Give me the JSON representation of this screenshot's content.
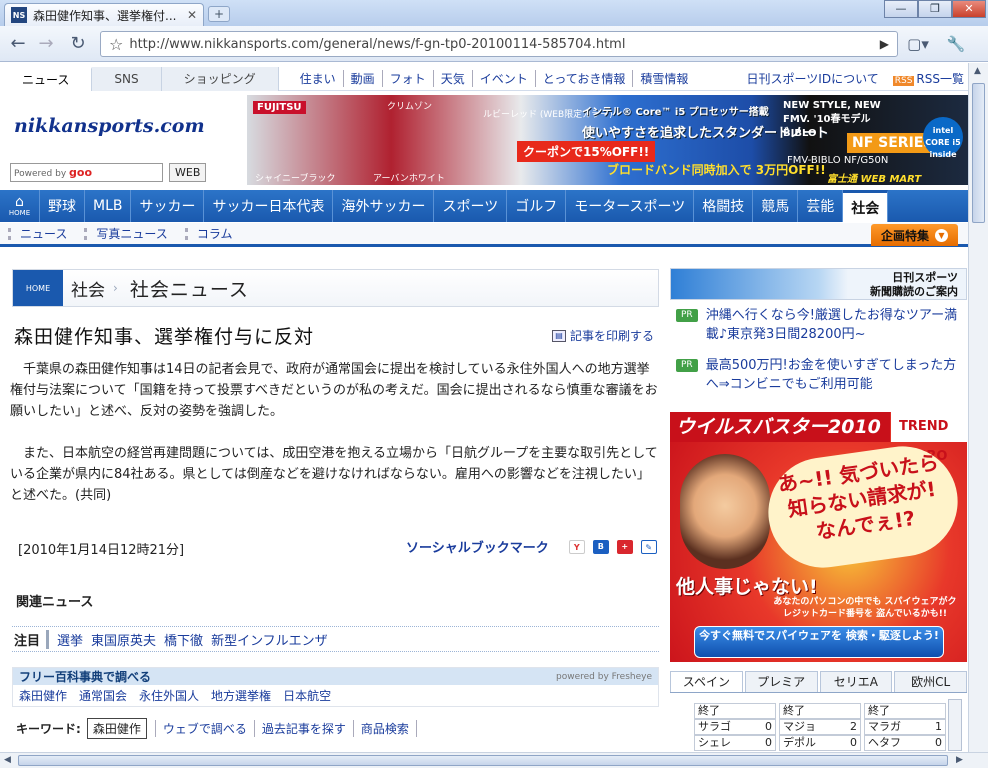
{
  "browser": {
    "tab_title": "森田健作知事、選挙権付...",
    "tab_favicon": "nikkansports-favicon",
    "url": "http://www.nikkansports.com/general/news/f-gn-tp0-20100114-585704.html"
  },
  "site": {
    "topnav_tabs": [
      "ニュース",
      "SNS",
      "ショッピング"
    ],
    "topnav_links": [
      "住まい",
      "動画",
      "フォト",
      "天気",
      "イベント",
      "とっておき情報",
      "積雪情報"
    ],
    "topnav_right": [
      "日刊スポーツIDについて",
      "RSS一覧"
    ],
    "logo": "nikkansports.com",
    "search_placeholder": "Powered by goo",
    "search_brand": "goo",
    "search_button": "WEB",
    "main_nav": [
      "野球",
      "MLB",
      "サッカー",
      "サッカー日本代表",
      "海外サッカー",
      "スポーツ",
      "ゴルフ",
      "モータースポーツ",
      "格闘技",
      "競馬",
      "芸能",
      "社会"
    ],
    "main_nav_home": "HOME",
    "sub_nav": [
      "ニュース",
      "写真ニュース",
      "コラム"
    ],
    "special_feature": "企画特集"
  },
  "banner": {
    "brand": "FUJITSU",
    "headline_small": "インテル® Core™ i5 プロセッサー搭載",
    "headline": "使いやすさを追求したスタンダードノート",
    "coupon": "クーポンで15%OFF!!",
    "price": "ブロードバンド同時加入で 3万円OFF!!",
    "biblo": "NEW STYLE, NEW FMV. '10春モデル BIBLO",
    "series": "NF SERIES",
    "model": "FMV-BIBLO NF/G50N",
    "webmart": "富士通 WEB MART",
    "colors": [
      "クリムゾン",
      "ルビーレッド (WEB限定カラー)",
      "シャイニーブラック",
      "アーバンホワイト"
    ],
    "intel_badge": "intel CORE i5 inside"
  },
  "article": {
    "breadcrumb_home": "HOME",
    "breadcrumb": [
      "社会",
      "社会ニュース"
    ],
    "title": "森田健作知事、選挙権付与に反対",
    "print_link": "記事を印刷する",
    "paragraphs": [
      "千葉県の森田健作知事は14日の記者会見で、政府が通常国会に提出を検討している永住外国人への地方選挙権付与法案について「国籍を持って投票すべきだというのが私の考えだ。国会に提出されるなら慎重な審議をお願いしたい」と述べ、反対の姿勢を強調した。",
      "また、日本航空の経営再建問題については、成田空港を抱える立場から「日航グループを主要な取引先としている企業が県内に84社ある。県としては倒産などを避けなければならない。雇用への影響などを注視したい」と述べた。(共同)"
    ],
    "dateline": "[2010年1月14日12時21分]",
    "social_bookmark": "ソーシャルブックマーク",
    "bookmark_icons": [
      "yahoo-bookmark-icon",
      "hatena-bookmark-icon",
      "livedoor-clip-icon",
      "edit-bookmark-icon"
    ],
    "related_label": "関連ニュース",
    "attention_label": "注目",
    "attention_links": [
      "選挙",
      "東国原英夫",
      "橋下徹",
      "新型インフルエンザ"
    ],
    "wiki_label": "フリー百科事典で調べる",
    "wiki_powered": "powered by Fresheye",
    "wiki_links": [
      "森田健作",
      "通常国会",
      "永住外国人",
      "地方選挙権",
      "日本航空"
    ],
    "keyword_label": "キーワード:",
    "keyword": "森田健作",
    "keyword_links": [
      "ウェブで調べる",
      "過去記事を探す",
      "商品検索"
    ]
  },
  "sidebar": {
    "subscribe_title": "日刊スポーツ",
    "subscribe_sub": "新聞購読のご案内",
    "pr": [
      {
        "badge": "PR",
        "text": "沖縄へ行くなら今!厳選したお得なツアー満載♪東京発3日間28200円~"
      },
      {
        "badge": "PR",
        "text": "最高500万円!お金を使いすぎてしまった方へ⇒コンビニでもご利用可能"
      }
    ],
    "virusbuster": {
      "title": "ウイルスバスター2010",
      "brand": "TREND MICRO",
      "bubble": "あ~!! 気づいたら 知らない請求が! なんでぇ!?",
      "tanin": "他人事じゃない!",
      "small": "あなたのパソコンの中でも スパイウェアがクレジットカード番号を 盗んでいるかも!!",
      "cta": "今すぐ無料でスパイウェアを 検索・駆逐しよう!"
    },
    "league_tabs": [
      "スペイン",
      "プレミア",
      "セリエA",
      "欧州CL"
    ],
    "scores": [
      [
        {
          "label": "終了",
          "value": ""
        },
        {
          "label": "終了",
          "value": ""
        },
        {
          "label": "終了",
          "value": ""
        }
      ],
      [
        {
          "label": "サラゴ",
          "value": "0"
        },
        {
          "label": "マジョ",
          "value": "2"
        },
        {
          "label": "マラガ",
          "value": "1"
        }
      ],
      [
        {
          "label": "シェレ",
          "value": "0"
        },
        {
          "label": "デポル",
          "value": "0"
        },
        {
          "label": "ヘタフ",
          "value": "0"
        }
      ]
    ]
  }
}
